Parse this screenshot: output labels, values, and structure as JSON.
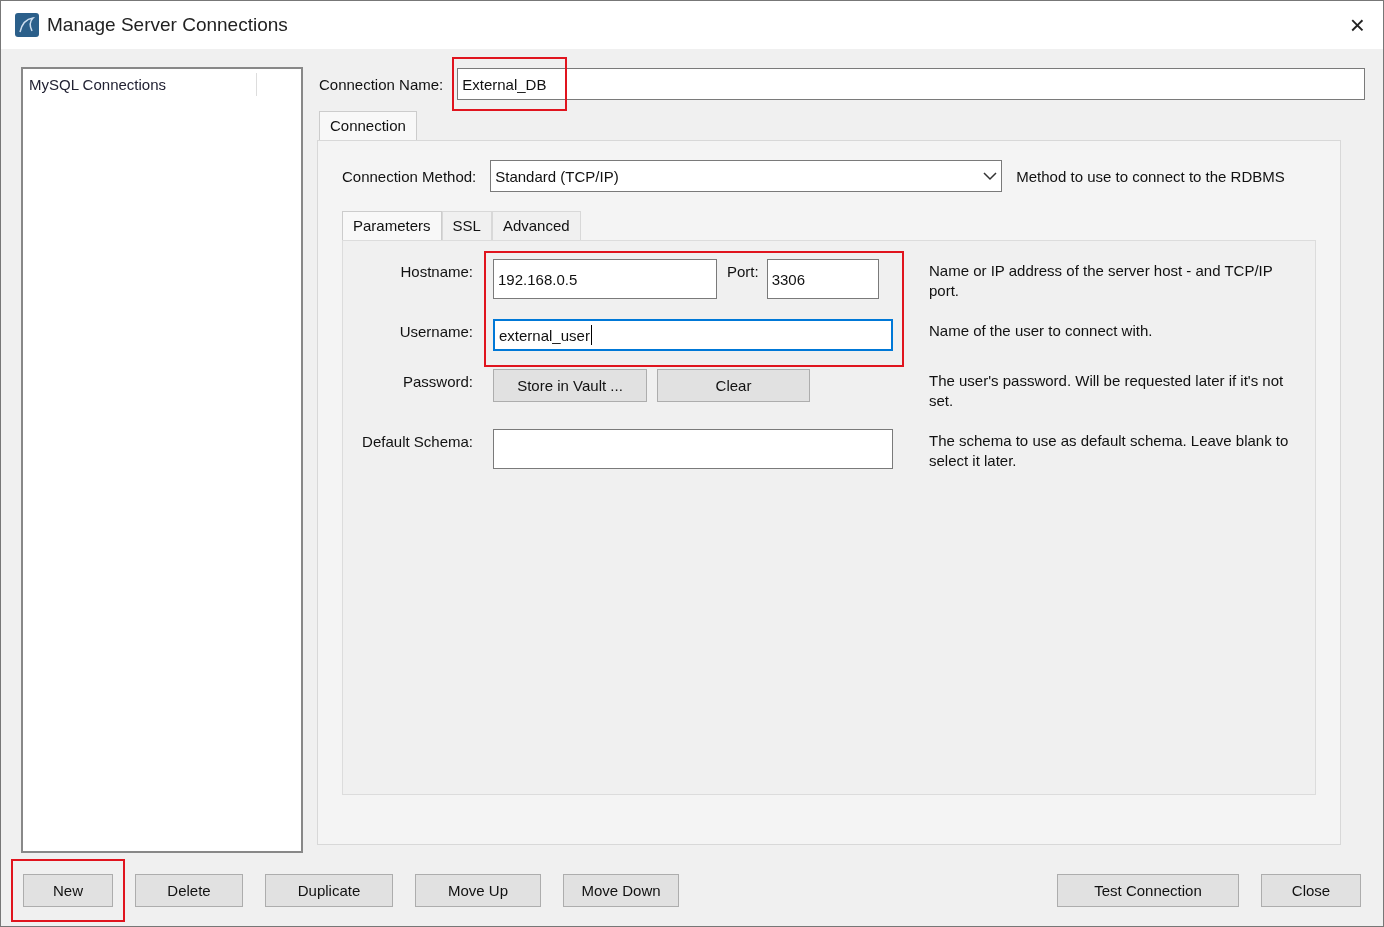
{
  "window": {
    "title": "Manage Server Connections",
    "close": "×"
  },
  "connections_list": {
    "header": "MySQL Connections"
  },
  "connection_name": {
    "label": "Connection Name:",
    "value": "External_DB",
    "highlighted": true
  },
  "tabs": [
    {
      "label": "Connection",
      "selected": true
    }
  ],
  "connection_method": {
    "label": "Connection Method:",
    "value": "Standard (TCP/IP)",
    "description": "Method to use to connect to the RDBMS"
  },
  "sub_tabs": [
    {
      "label": "Parameters",
      "selected": true
    },
    {
      "label": "SSL",
      "selected": false
    },
    {
      "label": "Advanced",
      "selected": false
    }
  ],
  "parameters": {
    "highlighted": true,
    "rows": [
      {
        "kind": "host_port",
        "label": "Hostname:",
        "value": "192.168.0.5",
        "port_label": "Port:",
        "port_value": "3306",
        "description": "Name or IP address of the server host - and TCP/IP port."
      },
      {
        "kind": "text",
        "label": "Username:",
        "value": "external_user",
        "focused": true,
        "description": "Name of the user to connect with."
      },
      {
        "kind": "buttons",
        "label": "Password:",
        "buttons": [
          "Store in Vault ...",
          "Clear"
        ],
        "description": "The user's password. Will be requested later if it's not set."
      },
      {
        "kind": "text",
        "label": "Default Schema:",
        "focused": false,
        "description": "The schema to use as default schema. Leave blank to select it later."
      }
    ]
  },
  "buttons_left": [
    {
      "label": "New",
      "highlighted": true
    },
    {
      "label": "Delete",
      "highlighted": false
    },
    {
      "label": "Duplicate",
      "highlighted": false
    },
    {
      "label": "Move Up",
      "highlighted": false
    },
    {
      "label": "Move Down",
      "highlighted": false
    }
  ],
  "buttons_right": [
    {
      "label": "Test Connection",
      "highlighted": false
    },
    {
      "label": "Close",
      "highlighted": false
    }
  ]
}
